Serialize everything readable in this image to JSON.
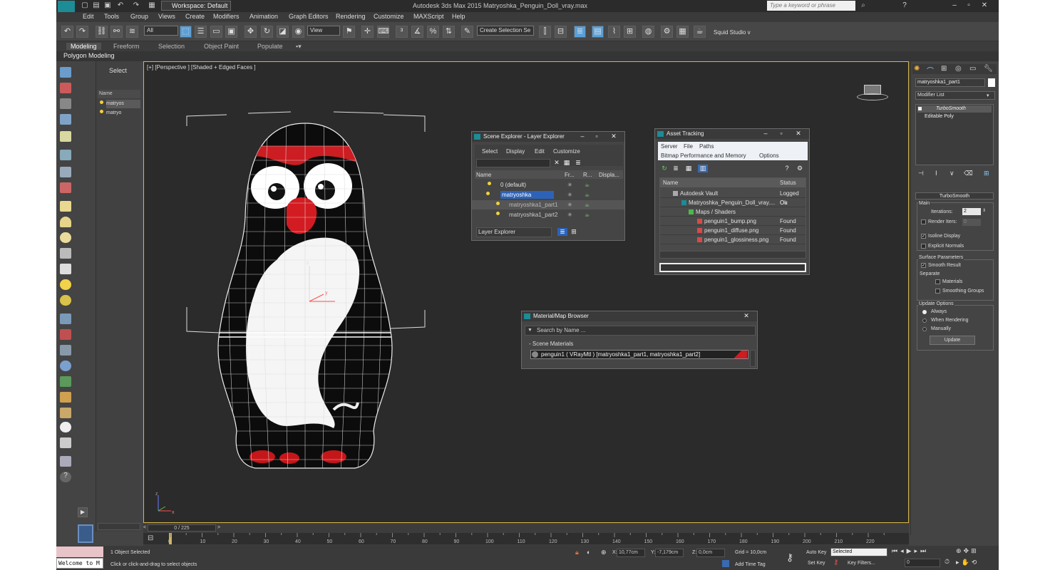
{
  "app": {
    "title": "Autodesk 3ds Max 2015    Matryoshka_Penguin_Doll_vray.max",
    "logo_label": "MAX",
    "workspace": "Workspace: Default",
    "search_placeholder": "Type a keyword or phrase"
  },
  "menu": [
    "Edit",
    "Tools",
    "Group",
    "Views",
    "Create",
    "Modifiers",
    "Animation",
    "Graph Editors",
    "Rendering",
    "Customize",
    "MAXScript",
    "Help"
  ],
  "toolbar": {
    "filter": "All",
    "ref_coord": "View",
    "selection_set": "Create Selection Se",
    "studio": "Squid Studio v"
  },
  "ribbon": {
    "tabs": [
      "Modeling",
      "Freeform",
      "Selection",
      "Object Paint",
      "Populate"
    ],
    "active": "Modeling",
    "subtab": "Polygon Modeling"
  },
  "explorer_side": {
    "header": "Select",
    "column": "Name",
    "rows": [
      "matryos",
      "matryo"
    ]
  },
  "viewport": {
    "label": "[+] [Perspective ] [Shaded + Edged Faces ]",
    "axis_z": "z",
    "axis_y": "y",
    "axis_x": "x"
  },
  "scene_explorer": {
    "title": "Scene Explorer - Layer Explorer",
    "menus": [
      "Select",
      "Display",
      "Edit",
      "Customize"
    ],
    "columns": [
      "Name",
      "Fr...",
      "R...",
      "Displa..."
    ],
    "rows": [
      "0 (default)",
      "matryoshka",
      "matryoshka1_part1",
      "matryoshka1_part2"
    ],
    "footer": "Layer Explorer"
  },
  "asset_tracking": {
    "title": "Asset Tracking",
    "menus": [
      "Server",
      "File",
      "Paths"
    ],
    "menus2": [
      "Bitmap Performance and Memory",
      "Options"
    ],
    "columns": [
      "Name",
      "Status"
    ],
    "rows": [
      {
        "name": "Autodesk Vault",
        "status": "Logged Ou"
      },
      {
        "name": "Matryoshka_Penguin_Doll_vray....",
        "status": "Ok"
      },
      {
        "name": "Maps / Shaders",
        "status": ""
      },
      {
        "name": "penguin1_bump.png",
        "status": "Found"
      },
      {
        "name": "penguin1_diffuse.png",
        "status": "Found"
      },
      {
        "name": "penguin1_glossiness.png",
        "status": "Found"
      }
    ]
  },
  "material_browser": {
    "title": "Material/Map Browser",
    "search": "Search by Name ...",
    "section": "- Scene Materials",
    "item": "penguin1 ( VRayMtl ) [matryoshka1_part1, matryoshka1_part2]"
  },
  "command_panel": {
    "object_name": "matryoshka1_part1",
    "modifier_list": "Modifier List",
    "stack": [
      "TurboSmooth",
      "Editable Poly"
    ],
    "rollout": "TurboSmooth",
    "main": "Main",
    "iterations_label": "Iterations:",
    "iterations_value": "2",
    "render_iters_label": "Render Iters:",
    "render_iters_value": "0",
    "isoline": "Isoline Display",
    "explicit": "Explicit Normals",
    "surface": "Surface Parameters",
    "smooth_result": "Smooth Result",
    "separate": "Separate",
    "materials": "Materials",
    "smoothing_groups": "Smoothing Groups",
    "update_options": "Update Options",
    "always": "Always",
    "when_rendering": "When Rendering",
    "manually": "Manually",
    "update_button": "Update"
  },
  "timeline": {
    "frame": "0 / 225",
    "ticks": [
      "0",
      "10",
      "20",
      "30",
      "40",
      "50",
      "60",
      "70",
      "80",
      "90",
      "100",
      "110",
      "120",
      "130",
      "140",
      "150",
      "160",
      "170",
      "180",
      "190",
      "200",
      "210",
      "220"
    ]
  },
  "status": {
    "welcome": "Welcome to M",
    "selected": "1 Object Selected",
    "prompt": "Click or click-and-drag to select objects",
    "x_label": "X:",
    "x": "10,77cm",
    "y_label": "Y:",
    "y": "-7,179cm",
    "z_label": "Z:",
    "z": "0,0cm",
    "grid": "Grid = 10,0cm",
    "add_time_tag": "Add Time Tag",
    "auto_key": "Auto Key",
    "set_key": "Set Key",
    "key_mode": "Selected",
    "key_filters": "Key Filters...",
    "frame_field": "0"
  },
  "colors": {
    "viewport_border": "#d6b44a",
    "accent": "#1c8c96",
    "selected_row": "#2c63b8"
  }
}
